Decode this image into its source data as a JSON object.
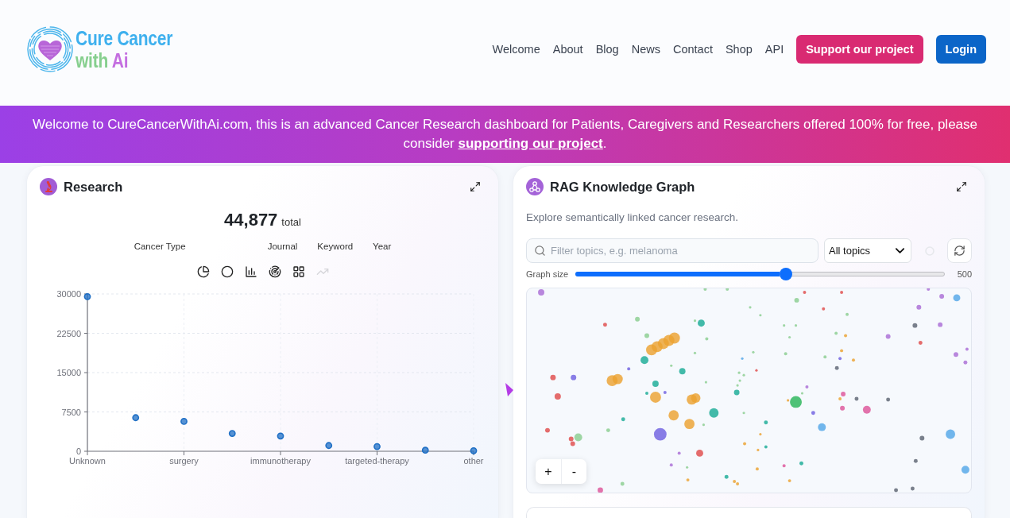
{
  "header": {
    "logo": {
      "title": "Cure Cancer",
      "tagline": [
        "with",
        "Ai"
      ]
    },
    "nav": [
      "Welcome",
      "About",
      "Blog",
      "News",
      "Contact",
      "Shop",
      "API"
    ],
    "buttons": [
      {
        "label": "Support our project",
        "kind": "support"
      },
      {
        "label": "Login",
        "kind": "login"
      }
    ]
  },
  "banner": {
    "text": "Welcome to CureCancerWithAi.com, this is an advanced Cancer Research dashboard for Patients, Caregivers and Researchers offered 100% for free, please consider",
    "link": "supporting our project",
    "end": "."
  },
  "research": {
    "title": "Research",
    "total": "44,877",
    "total_label": "total",
    "tabs": [
      "Cancer Type",
      "Journal",
      "Keyword",
      "Year"
    ],
    "chart_types": [
      {
        "kind": "pie",
        "disabled": false
      },
      {
        "kind": "donut",
        "disabled": false
      },
      {
        "kind": "bar",
        "disabled": false
      },
      {
        "kind": "radar",
        "disabled": false
      },
      {
        "kind": "grid",
        "disabled": false
      },
      {
        "kind": "line",
        "disabled": true
      }
    ],
    "chart_data": {
      "type": "scatter",
      "categories": [
        "Unknown",
        null,
        "surgery",
        null,
        "immunotherapy",
        null,
        "targeted-therapy",
        null,
        "other"
      ],
      "series": [
        {
          "color": "#1f6fc5",
          "values": [
            29500,
            6400,
            5700,
            3400,
            2900,
            1100,
            900,
            200,
            100
          ]
        }
      ],
      "ylim": [
        0,
        30000
      ],
      "yticks": [
        0,
        7500,
        15000,
        22500,
        30000
      ],
      "grid": true
    }
  },
  "knowledge_graph": {
    "title": "RAG Knowledge Graph",
    "description": "Explore semantically linked cancer research.",
    "filter": {
      "placeholder": "Filter topics, e.g. melanoma"
    },
    "topic_select": {
      "value": "All topics"
    },
    "graph_size": {
      "label": "Graph size",
      "level": 0.57,
      "reading": "500"
    },
    "zoom_buttons": [
      "+",
      "-"
    ]
  }
}
